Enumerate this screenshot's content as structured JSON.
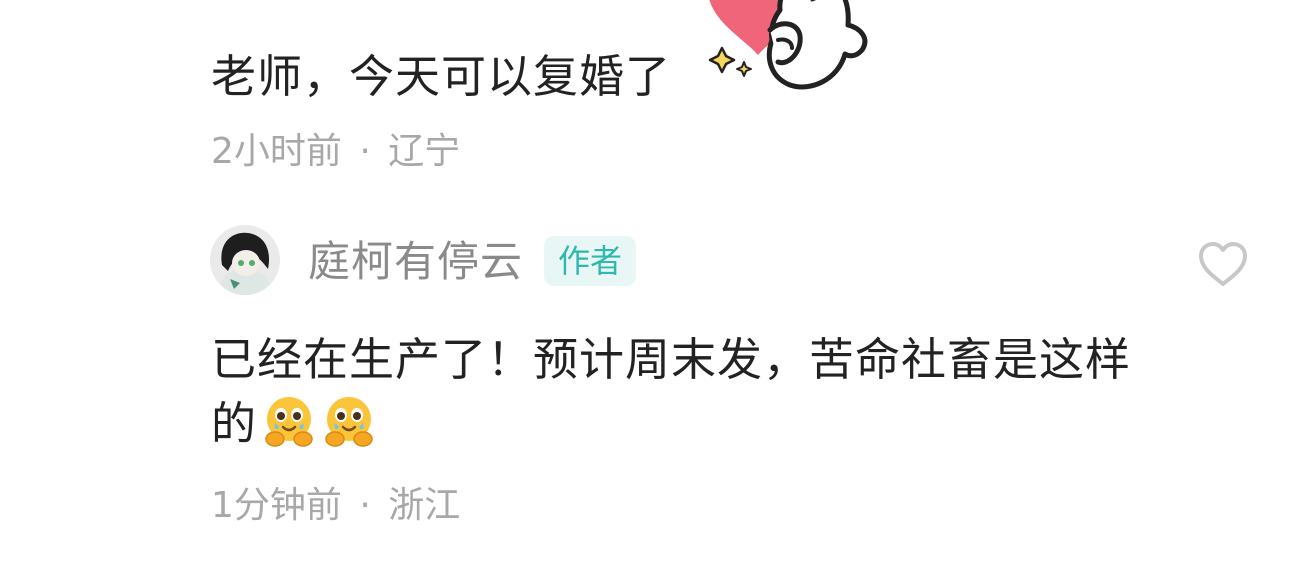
{
  "first_comment": {
    "text": "老师，今天可以复婚了",
    "time": "2小时前",
    "separator": "·",
    "location": "辽宁",
    "sticker": "duck-holding-heart-sticker"
  },
  "reply": {
    "username": "庭柯有停云",
    "badge": "作者",
    "text": "已经在生产了！预计周末发，苦命社畜是这样的",
    "emojis": [
      "crying-hug-emoji",
      "crying-hug-emoji"
    ],
    "time": "1分钟前",
    "separator": "·",
    "location": "浙江",
    "like_icon": "heart-outline-icon"
  },
  "colors": {
    "text": "#222222",
    "meta": "#a8a8a8",
    "username": "#8a8a8a",
    "badge_bg": "#e8f7f6",
    "badge_text": "#2fb8ad",
    "like_icon": "#c8c8c8"
  }
}
